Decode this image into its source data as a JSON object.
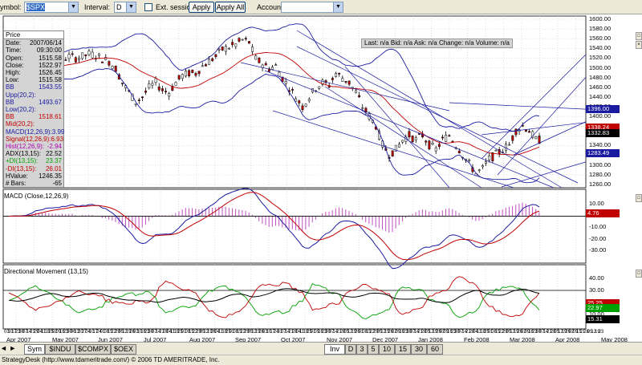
{
  "toolbar": {
    "symbol_label": "ymbol:",
    "symbol_value": "$SPX",
    "interval_label": "Interval:",
    "interval_value": "D",
    "ext_session_label": "Ext. session",
    "apply_label": "Apply",
    "apply_all_label": "Apply All",
    "account_label": "Account:",
    "account_value": ""
  },
  "info_panel": {
    "header": "Price",
    "rows": [
      {
        "label": "Date:",
        "value": "2007/06/14",
        "color": "#000000"
      },
      {
        "label": "Time:",
        "value": "09:30:00",
        "color": "#000000"
      },
      {
        "label": "Open:",
        "value": "1515.58",
        "color": "#000000"
      },
      {
        "label": "Close:",
        "value": "1522.97",
        "color": "#000000"
      },
      {
        "label": "High:",
        "value": "1526.45",
        "color": "#000000"
      },
      {
        "label": "Low:",
        "value": "1515.58",
        "color": "#000000"
      },
      {
        "label": "BB Upp(20,2):",
        "value": "1543.55",
        "color": "#1a1aa0"
      },
      {
        "label": "BB Low(20,2):",
        "value": "1493.67",
        "color": "#1a1aa0"
      },
      {
        "label": "BB Mid(20,2):",
        "value": "1518.61",
        "color": "#c00000"
      },
      {
        "label": "MACD(12,26,9):",
        "value": "3.99",
        "color": "#1a1aa0"
      },
      {
        "label": "Signal(12,26,9):",
        "value": "6.93",
        "color": "#c00000"
      },
      {
        "label": "Hist(12,26,9):",
        "value": "-2.94",
        "color": "#b000b0"
      },
      {
        "label": "ADX(13,15):",
        "value": "22.52",
        "color": "#000000"
      },
      {
        "label": "+DI(13,15):",
        "value": "23.37",
        "color": "#00a000"
      },
      {
        "label": "-DI(13,15):",
        "value": "26.01",
        "color": "#c00000"
      },
      {
        "label": "HValue:",
        "value": "1246.35",
        "color": "#000000"
      },
      {
        "label": "# Bars:",
        "value": "-65",
        "color": "#000000"
      }
    ]
  },
  "quote_bar": "Last: n/a  Bid: n/a  Ask: n/a  Change: n/a  Volume: n/a",
  "price_axis": [
    "1600.00",
    "1580.00",
    "1560.00",
    "1540.00",
    "1520.00",
    "1500.00",
    "1480.00",
    "1460.00",
    "1440.00",
    "1420.00",
    "1400.00",
    "1380.00",
    "1360.00",
    "1340.00",
    "1320.00",
    "1300.00",
    "1280.00",
    "1260.00"
  ],
  "price_tags": [
    {
      "value": "1396.00",
      "bg": "#1a1aa0",
      "fg": "#ffffff"
    },
    {
      "value": "1338.24",
      "bg": "#c00000",
      "fg": "#ffffff"
    },
    {
      "value": "1332.83",
      "bg": "#000000",
      "fg": "#ffffff"
    },
    {
      "value": "1283.49",
      "bg": "#1a1aa0",
      "fg": "#ffffff"
    }
  ],
  "macd_pane": {
    "title": "MACD (Close,12,26,9)",
    "axis": [
      "10.00",
      "0.00",
      "-10.00",
      "-20.00",
      "-30.00"
    ],
    "tags": [
      {
        "value": "4.76",
        "bg": "#c00000",
        "fg": "#ffffff"
      }
    ]
  },
  "dm_pane": {
    "title": "Directional Movement (13,15)",
    "axis": [
      "40.00",
      "30.00",
      "20.00",
      "10.00"
    ],
    "tags": [
      {
        "value": "25.25",
        "bg": "#c00000",
        "fg": "#ffffff"
      },
      {
        "value": "22.97",
        "bg": "#00a000",
        "fg": "#ffffff"
      },
      {
        "value": "15.31",
        "bg": "#000000",
        "fg": "#ffffff"
      }
    ]
  },
  "x_axis": {
    "days": [
      "03",
      "10",
      "17",
      "23",
      "30",
      "07",
      "14",
      "21",
      "29",
      "04",
      "11",
      "18",
      "25",
      "02",
      "09",
      "16",
      "23",
      "30",
      "06",
      "13",
      "20",
      "27",
      "04",
      "10",
      "17",
      "24",
      "01",
      "08",
      "15",
      "22",
      "29",
      "05",
      "12",
      "19",
      "26",
      "03",
      "10",
      "16",
      "23",
      "30",
      "07",
      "14",
      "21",
      "28",
      "04",
      "11",
      "18",
      "25",
      "01",
      "08",
      "15",
      "22",
      "29",
      "05",
      "12",
      "19",
      "26",
      "04",
      "11",
      "18",
      "25",
      "01",
      "08",
      "15",
      "22",
      "29",
      "05",
      "12",
      "19",
      "26",
      "03",
      "10",
      "17",
      "24",
      "31",
      "07",
      "14",
      "21",
      "28",
      "04",
      "11",
      "18",
      "25",
      "01",
      "09",
      "16",
      "23",
      "30",
      "07",
      "14",
      "21",
      "28",
      "05",
      "12",
      "19",
      "26",
      "01",
      "08",
      "15",
      "22",
      "29",
      "05",
      "12",
      "19",
      "26",
      "02",
      "09",
      "16",
      "23",
      "30",
      "07",
      "14",
      "21",
      "28",
      "05",
      "12",
      "19",
      "26",
      "02",
      "09",
      "16",
      "23",
      "30",
      "07",
      "14",
      "21",
      "28",
      "04",
      "11",
      "18",
      "25",
      "01",
      "08",
      "15",
      "22",
      "29",
      "05",
      "12",
      "19",
      "26",
      "02",
      "09",
      "16",
      "23",
      "30",
      "07",
      "14",
      "21",
      "28",
      "05",
      "12",
      "19",
      "26",
      "02",
      "09",
      "15",
      "21",
      "28",
      "05",
      "12",
      "19",
      "23"
    ],
    "months": [
      "Apr 2007",
      "May 2007",
      "Jun 2007",
      "Jul 2007",
      "Aug 2007",
      "Sep 2007",
      "Oct 2007",
      "Nov 2007",
      "Dec 2007",
      "Jan 2008",
      "Feb 2008",
      "Mar 2008",
      "Apr 2008",
      "May 2008"
    ]
  },
  "tabs": {
    "left": [
      {
        "label": "Sym",
        "active": true
      },
      {
        "label": "$INDU",
        "active": false
      },
      {
        "label": "$COMPX",
        "active": false
      },
      {
        "label": "$OEX",
        "active": false
      }
    ],
    "right": [
      {
        "label": "Inv",
        "active": true
      },
      {
        "label": "D",
        "active": false
      },
      {
        "label": "3",
        "active": false
      },
      {
        "label": "5",
        "active": false
      },
      {
        "label": "10",
        "active": false
      },
      {
        "label": "15",
        "active": false
      },
      {
        "label": "30",
        "active": false
      },
      {
        "label": "60",
        "active": false
      }
    ]
  },
  "status_text": "StrategyDesk (http://www.tdameritrade.com/) © 2006 TD AMERITRADE, Inc.",
  "colors": {
    "bull": "#ffffff",
    "bear": "#c00000",
    "bb": "#1a1aa0",
    "mid": "#c00000",
    "macd": "#1a1aa0",
    "signal": "#c00000",
    "hist": "#c050c0",
    "adx": "#000000",
    "plus_di": "#00a000",
    "minus_di": "#c00000"
  },
  "chart_data": {
    "type": "candlestick",
    "price_range": [
      1250,
      1610
    ],
    "close_path": [
      1490,
      1495,
      1500,
      1505,
      1510,
      1512,
      1515,
      1518,
      1520,
      1525,
      1522,
      1525,
      1530,
      1528,
      1520,
      1515,
      1500,
      1470,
      1450,
      1430,
      1440,
      1460,
      1470,
      1455,
      1450,
      1470,
      1485,
      1490,
      1490,
      1505,
      1515,
      1525,
      1540,
      1545,
      1550,
      1560,
      1555,
      1520,
      1510,
      1500,
      1505,
      1480,
      1460,
      1440,
      1420,
      1440,
      1460,
      1470,
      1465,
      1490,
      1480,
      1470,
      1450,
      1420,
      1400,
      1380,
      1340,
      1320,
      1330,
      1350,
      1360,
      1350,
      1360,
      1340,
      1330,
      1350,
      1360,
      1340,
      1320,
      1300,
      1280,
      1290,
      1310,
      1320,
      1330,
      1340,
      1370,
      1380,
      1370,
      1350
    ],
    "macd_range": [
      -35,
      20
    ],
    "dm_range": [
      0,
      50
    ]
  }
}
